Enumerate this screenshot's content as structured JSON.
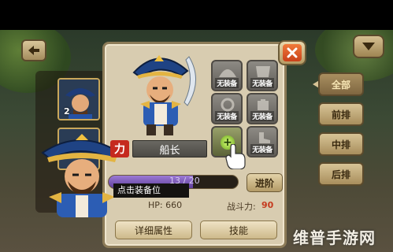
{
  "nav": {
    "back_icon": "back-arrow-icon",
    "menu_icon": "chevron-down-icon",
    "close_icon": "close-icon"
  },
  "hero_list": {
    "slots": [
      {
        "index": "2"
      },
      {
        "index": ""
      }
    ]
  },
  "equip_slots": [
    {
      "label": "无装备"
    },
    {
      "label": "无装备"
    },
    {
      "label": "无装备"
    },
    {
      "label": "无装备"
    },
    {
      "label": "+"
    },
    {
      "label": "无装备"
    }
  ],
  "hero": {
    "strength_badge": "力",
    "name": "船长",
    "exp_text": "13 / 20",
    "exp_fraction": 0.65,
    "hp": "HP: 660",
    "power_label": "战斗力:",
    "power_value": "90"
  },
  "tooltip": "点击装备位",
  "buttons": {
    "advance": "进阶",
    "detail": "详细属性",
    "skill": "技能"
  },
  "tabs": [
    {
      "label": "全部",
      "active": true
    },
    {
      "label": "前排",
      "active": false
    },
    {
      "label": "中排",
      "active": false
    },
    {
      "label": "后排",
      "active": false
    }
  ],
  "watermark": "维普手游网",
  "colors": {
    "accent_red": "#c52a1e",
    "exp_purple": "#6a47a8",
    "panel_bg": "#d8ccb0"
  }
}
